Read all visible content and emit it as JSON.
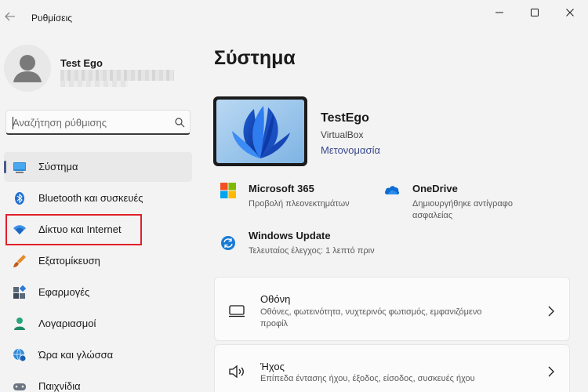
{
  "window": {
    "title": "Ρυθμίσεις"
  },
  "profile": {
    "name": "Test Ego"
  },
  "search": {
    "placeholder": "Αναζήτηση ρύθμισης"
  },
  "sidebar": {
    "items": [
      {
        "label": "Σύστημα",
        "icon": "system-display-icon",
        "active": true
      },
      {
        "label": "Bluetooth και συσκευές",
        "icon": "bluetooth-icon"
      },
      {
        "label": "Δίκτυο και Internet",
        "icon": "wifi-icon",
        "highlighted": true
      },
      {
        "label": "Εξατομίκευση",
        "icon": "paintbrush-icon"
      },
      {
        "label": "Εφαρμογές",
        "icon": "apps-icon"
      },
      {
        "label": "Λογαριασμοί",
        "icon": "person-icon"
      },
      {
        "label": "Ώρα και γλώσσα",
        "icon": "globe-clock-icon"
      },
      {
        "label": "Παιχνίδια",
        "icon": "gamepad-icon"
      }
    ]
  },
  "main": {
    "title": "Σύστημα",
    "device": {
      "name": "TestEgo",
      "model": "VirtualBox",
      "rename_label": "Μετονομασία"
    },
    "tiles": [
      {
        "title": "Microsoft 365",
        "subtitle": "Προβολή πλεονεκτημάτων",
        "icon": "microsoft-logo-icon"
      },
      {
        "title": "OneDrive",
        "subtitle_line1": "Δημιουργήθηκε αντίγραφο",
        "subtitle_line2": "ασφαλείας",
        "icon": "onedrive-cloud-icon"
      },
      {
        "title": "Windows Update",
        "subtitle": "Τελευταίος έλεγχος: 1 λεπτό πριν",
        "icon": "windows-update-icon"
      }
    ],
    "cards": [
      {
        "title": "Οθόνη",
        "subtitle_line1": "Οθόνες, φωτεινότητα, νυχτερινός φωτισμός, εμφανιζόμενο",
        "subtitle_line2": "προφίλ",
        "icon": "monitor-icon"
      },
      {
        "title": "Ήχος",
        "subtitle": "Επίπεδα έντασης ήχου, έξοδος, είσοδος, συσκευές ήχου",
        "icon": "speaker-icon"
      }
    ]
  },
  "colors": {
    "accent": "#4d5a8f",
    "link": "#3a4a8f",
    "highlight_box": "#e0202a",
    "background": "#f3f3f3"
  }
}
